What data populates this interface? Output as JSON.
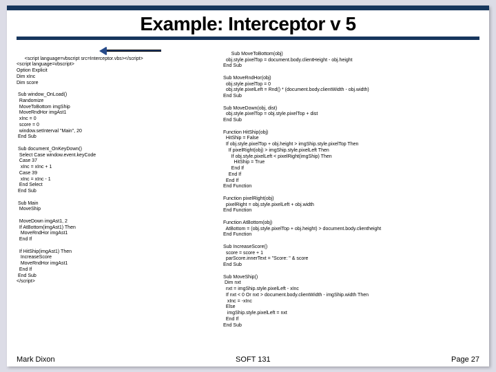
{
  "title": "Example: Interceptor v 5",
  "footer": {
    "left": "Mark Dixon",
    "center": "SOFT 131",
    "right": "Page 27"
  },
  "arrow_name": "arrow-annotation",
  "code_left": "<script language=vbscript src=Interceptor.vbs></script>\n<script language=vbscript>\nOption Explicit\nDim xInc\nDim score\n\n Sub window_OnLoad()\n  Randomize\n  MoveToBottom imgShip\n  MoveRndHor imgAst1\n  xInc = 0\n  score = 0\n  window.setInterval \"Main\", 20\n End Sub\n\n Sub document_OnKeyDown()\n  Select Case window.event.keyCode\n  Case 37\n   xInc = xInc + 1\n  Case 39\n   xInc = xInc - 1\n  End Select\n End Sub\n\n Sub Main\n  MoveShip\n\n  MoveDown imgAst1, 2\n  If AtBottom(imgAst1) Then\n   MoveRndHor imgAst1\n  End If\n\n  If HitShip(imgAst1) Then\n   IncreaseScore\n   MoveRndHor imgAst1\n  End If\n End Sub\n</script>",
  "code_right": "Sub MoveToBottom(obj)\n  obj.style.pixelTop = document.body.clientHeight - obj.height\nEnd Sub\n\nSub MoveRndHor(obj)\n  obj.style.pixelTop = 0\n  obj.style.pixelLeft = Rnd() * (document.body.clientWidth - obj.width)\nEnd Sub\n\nSub MoveDown(obj, dist)\n  obj.style.pixelTop = obj.style.pixelTop + dist\nEnd Sub\n\nFunction HitShip(obj)\n  HitShip = False\n  If obj.style.pixelTop + obj.height > imgShip.style.pixelTop Then\n    If pixelRight(obj) > imgShip.style.pixelLeft Then\n      If obj.style.pixelLeft < pixelRight(imgShip) Then\n        HitShip = True\n      End If\n    End If\n  End If\nEnd Function\n\nFunction pixelRight(obj)\n  pixelRight = obj.style.pixelLeft + obj.width\nEnd Function\n\nFunction AtBottom(obj)\n  AtBottom = (obj.style.pixelTop + obj.height) > document.body.clientheight\nEnd Function\n\nSub IncreaseScore()\n  score = score + 1\n  parScore.innerText = \"Score: \" & score\nEnd Sub\n\nSub MoveShip()\n Dim nxt\n  nxt = imgShip.style.pixelLeft - xInc\n  If nxt < 0 Or nxt > document.body.clientWidth - imgShip.width Then\n   xInc = -xInc\n  Else\n   imgShip.style.pixelLeft = nxt\n  End If\nEnd Sub"
}
